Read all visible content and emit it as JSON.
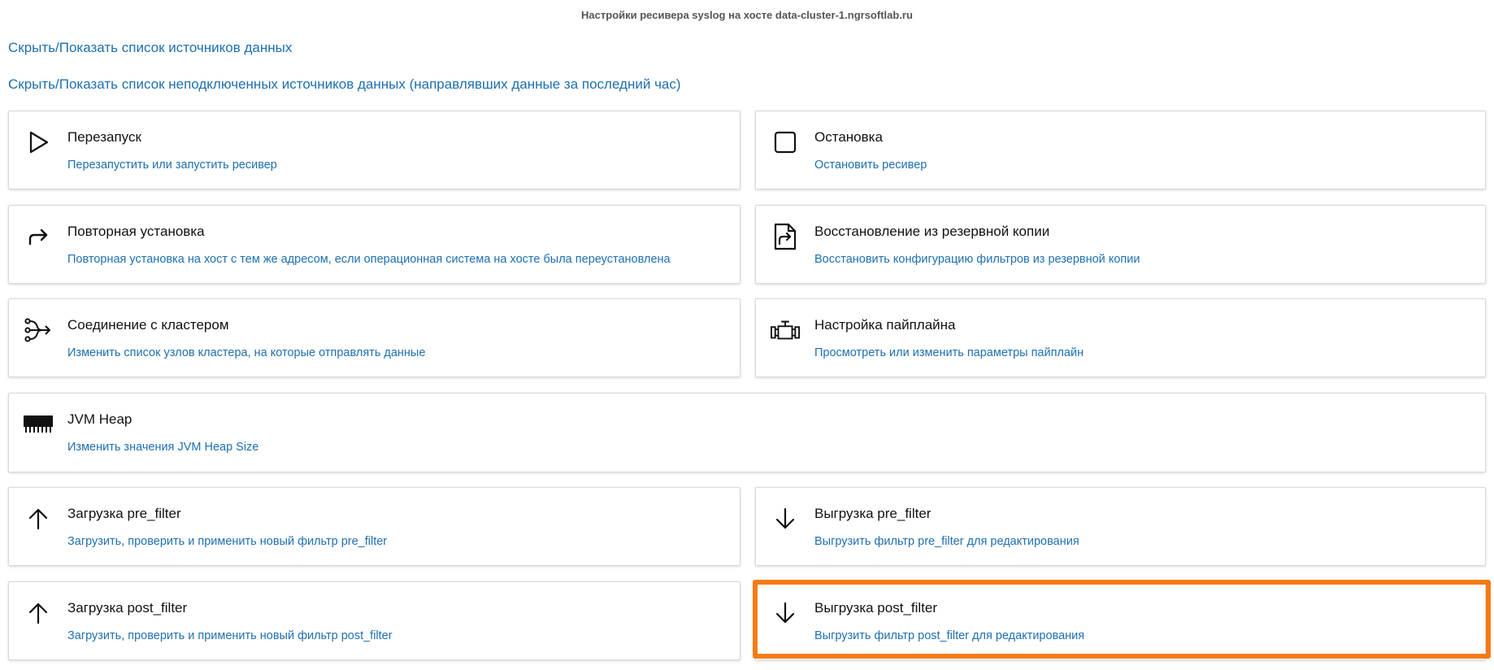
{
  "header": {
    "title": "Настройки ресивера syslog на хосте data-cluster-1.ngrsoftlab.ru"
  },
  "links": {
    "toggle_sources": "Скрыть/Показать список источников данных",
    "toggle_unconnected": "Скрыть/Показать список неподключенных источников данных (направлявших данные за последний час)"
  },
  "actions": {
    "restart": {
      "title": "Перезапуск",
      "description": "Перезапустить или запустить ресивер",
      "icon": "play-icon"
    },
    "stop": {
      "title": "Остановка",
      "description": "Остановить ресивер",
      "icon": "stop-icon"
    },
    "reinstall": {
      "title": "Повторная установка",
      "description": "Повторная установка на хост с тем же адресом, если операционная система на хосте была переустановлена",
      "icon": "redo-arrow-icon"
    },
    "restore": {
      "title": "Восстановление из резервной копии",
      "description": "Восстановить конфигурацию фильтров из резервной копии",
      "icon": "file-restore-icon"
    },
    "cluster": {
      "title": "Соединение с кластером",
      "description": "Изменить список узлов кластера, на которые отправлять данные",
      "icon": "merge-arrows-icon"
    },
    "pipeline": {
      "title": "Настройка пайплайна",
      "description": "Просмотреть или изменить параметры пайплайн",
      "icon": "pipeline-icon"
    },
    "jvm_heap": {
      "title": "JVM Heap",
      "description": "Изменить значения JVM Heap Size",
      "icon": "memory-icon"
    },
    "upload_pre_filter": {
      "title": "Загрузка pre_filter",
      "description": "Загрузить, проверить и применить новый фильтр pre_filter",
      "icon": "arrow-up-icon"
    },
    "download_pre_filter": {
      "title": "Выгрузка pre_filter",
      "description": "Выгрузить фильтр pre_filter для редактирования",
      "icon": "arrow-down-icon"
    },
    "upload_post_filter": {
      "title": "Загрузка post_filter",
      "description": "Загрузить, проверить и применить новый фильтр post_filter",
      "icon": "arrow-up-icon"
    },
    "download_post_filter": {
      "title": "Выгрузка post_filter",
      "description": "Выгрузить фильтр post_filter для редактирования",
      "icon": "arrow-down-icon"
    }
  },
  "colors": {
    "link": "#1e6fb0",
    "highlight": "#f47b16",
    "card_border": "#d9d9d9"
  }
}
